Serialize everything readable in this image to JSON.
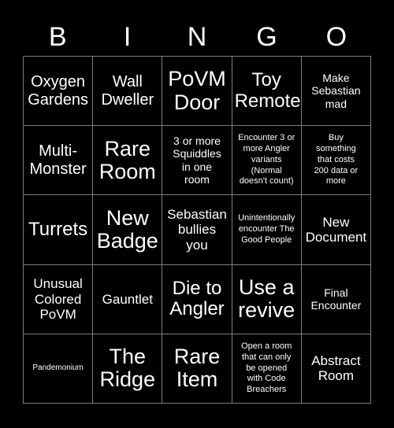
{
  "card": {
    "title": "BINGO",
    "background_color": "#000000",
    "text_color": "#ffffff",
    "grid_line_color": "#7d7d7d",
    "size": "5x5"
  },
  "header": {
    "letters": [
      {
        "label": "B"
      },
      {
        "label": "I"
      },
      {
        "label": "N"
      },
      {
        "label": "G"
      },
      {
        "label": "O"
      }
    ]
  },
  "grid": {
    "rows": [
      {
        "cells": [
          {
            "text": "Oxygen\nGardens",
            "size": "md"
          },
          {
            "text": "Wall\nDweller",
            "size": "md"
          },
          {
            "text": "PoVM\nDoor",
            "size": "xl"
          },
          {
            "text": "Toy\nRemote",
            "size": "lg"
          },
          {
            "text": "Make\nSebastian\nmad",
            "size": "xs"
          }
        ]
      },
      {
        "cells": [
          {
            "text": "Multi-\nMonster",
            "size": "md"
          },
          {
            "text": "Rare\nRoom",
            "size": "xl"
          },
          {
            "text": "3 or more\nSquiddles\nin one\nroom",
            "size": "xs"
          },
          {
            "text": "Encounter 3 or\nmore Angler\nvariants\n(Normal\ndoesn't count)",
            "size": "xxs"
          },
          {
            "text": "Buy\nsomething\nthat costs\n200 data or\nmore",
            "size": "xxs"
          }
        ]
      },
      {
        "cells": [
          {
            "text": "Turrets",
            "size": "lg"
          },
          {
            "text": "New\nBadge",
            "size": "xl"
          },
          {
            "text": "Sebastian\nbullies\nyou",
            "size": "sm"
          },
          {
            "text": "Unintentionally\nencounter The\nGood People",
            "size": "xxs"
          },
          {
            "text": "New\nDocument",
            "size": "sm"
          }
        ]
      },
      {
        "cells": [
          {
            "text": "Unusual\nColored\nPoVM",
            "size": "sm"
          },
          {
            "text": "Gauntlet",
            "size": "sm"
          },
          {
            "text": "Die to\nAngler",
            "size": "lg"
          },
          {
            "text": "Use a\nrevive",
            "size": "xl"
          },
          {
            "text": "Final\nEncounter",
            "size": "xs"
          }
        ]
      },
      {
        "cells": [
          {
            "text": "Pandemonium",
            "size": "tiny"
          },
          {
            "text": "The\nRidge",
            "size": "xl"
          },
          {
            "text": "Rare\nItem",
            "size": "xl"
          },
          {
            "text": "Open a room\nthat can only\nbe opened\nwith Code\nBreachers",
            "size": "xxs"
          },
          {
            "text": "Abstract\nRoom",
            "size": "sm"
          }
        ]
      }
    ]
  }
}
